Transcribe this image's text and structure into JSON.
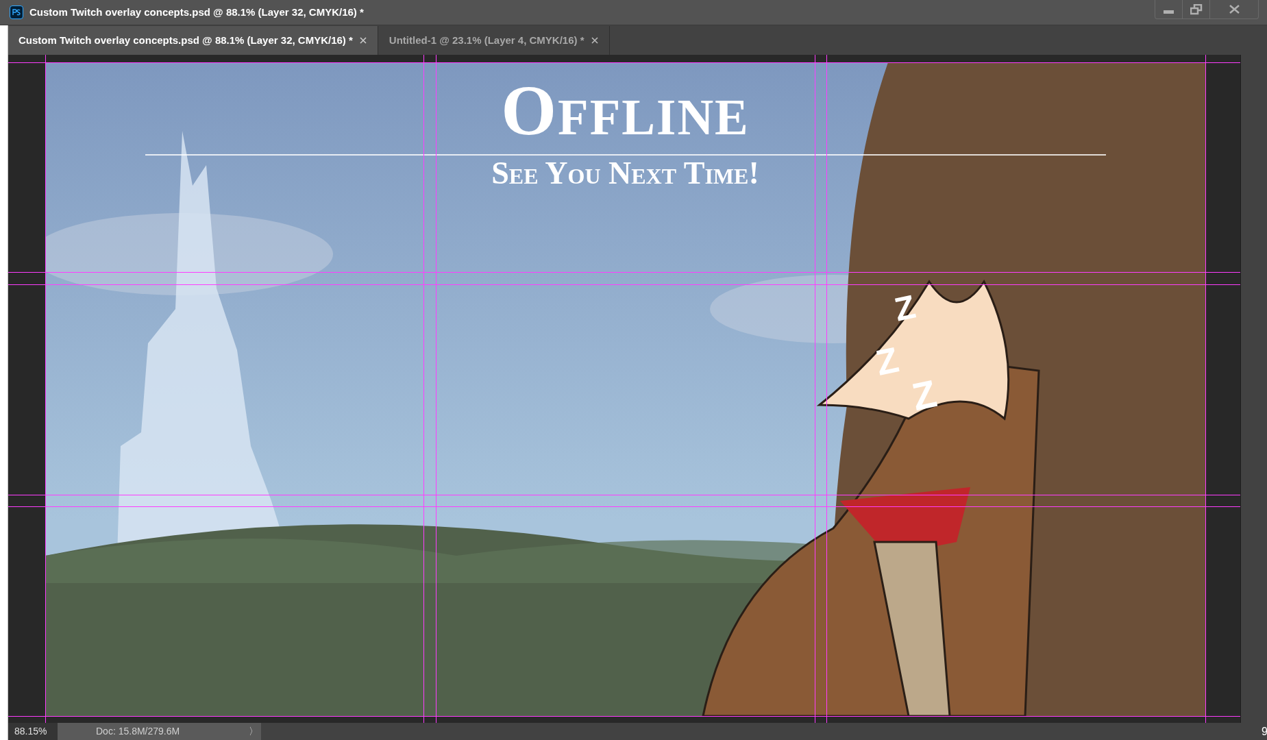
{
  "window": {
    "title": "Custom Twitch overlay concepts.psd @ 88.1% (Layer 32, CMYK/16) *"
  },
  "tabs": [
    {
      "label": "Custom Twitch overlay concepts.psd @ 88.1% (Layer 32, CMYK/16) *",
      "selected": true
    },
    {
      "label": "Untitled-1 @ 23.1% (Layer 4, CMYK/16) *",
      "selected": false
    }
  ],
  "canvas": {
    "heading": "Offline",
    "subheading": "See You Next Time!",
    "sleep_letters": [
      "Z",
      "Z",
      "Z"
    ]
  },
  "status_bar": {
    "zoom": "88.15%",
    "doc": "Doc: 15.8M/279.6M",
    "arrow": "〉",
    "edge_text": "9"
  }
}
